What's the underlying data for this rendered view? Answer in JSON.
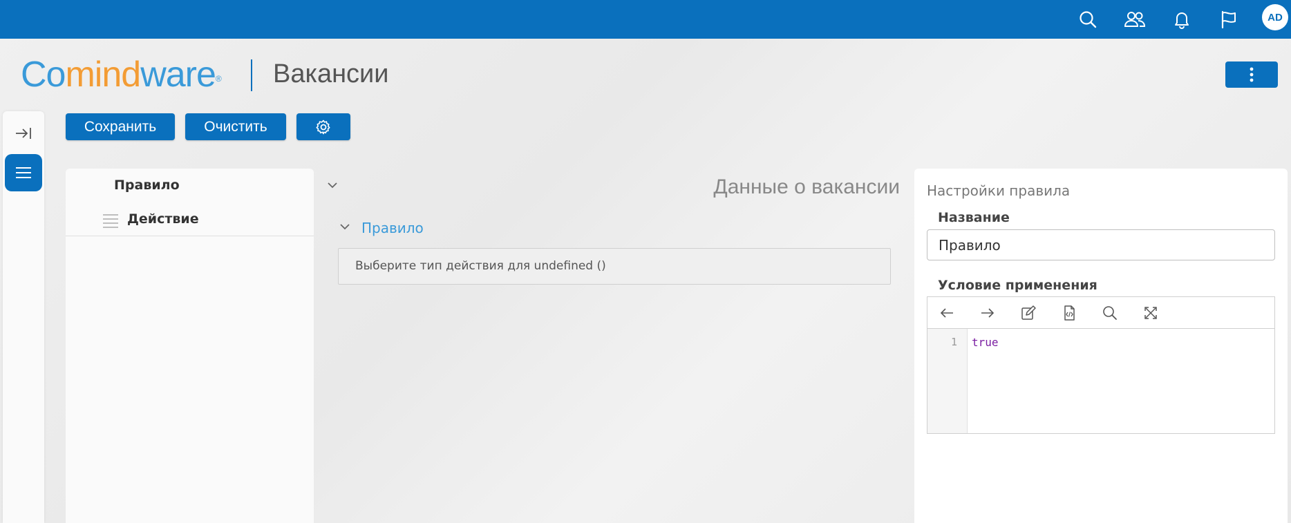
{
  "colors": {
    "brand": "#0a70bd",
    "logo_blue": "#3a9ad9",
    "logo_orange": "#f39c34",
    "code_keyword": "#7b1fa2"
  },
  "topbar": {
    "icons": [
      "search-icon",
      "users-icon",
      "bell-icon",
      "flag-icon"
    ],
    "avatar_initials": "AD"
  },
  "header": {
    "logo_part1": "Co",
    "logo_part2": "mind",
    "logo_part3": "ware",
    "logo_reg": "®",
    "page_title": "Вакансии"
  },
  "toolbar": {
    "save_label": "Сохранить",
    "clear_label": "Очистить",
    "settings_icon": "gear-icon"
  },
  "tree": {
    "rule_label": "Правило",
    "action_label": "Действие"
  },
  "main": {
    "title": "Данные о вакансии",
    "section_label": "Правило",
    "info_text": "Выберите тип действия для undefined ()"
  },
  "rule_settings": {
    "heading": "Настройки правила",
    "name_label": "Название",
    "name_value": "Правило",
    "condition_label": "Условие применения",
    "editor": {
      "toolbar_icons": [
        "arrow-left-icon",
        "arrow-right-icon",
        "edit-icon",
        "code-file-icon",
        "search-icon",
        "expand-icon"
      ],
      "line_number": "1",
      "code": "true"
    }
  }
}
